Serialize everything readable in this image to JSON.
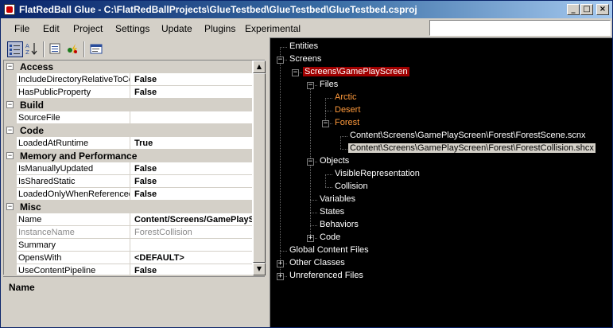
{
  "window": {
    "title": "FlatRedBall Glue - C:\\FlatRedBallProjects\\GlueTestbed\\GlueTestbed\\GlueTestbed.csproj",
    "buttons": {
      "minimize": "_",
      "maximize": "□",
      "close": "×"
    }
  },
  "menu": [
    "File",
    "Edit",
    "Project",
    "Settings",
    "Update",
    "Plugins",
    "Experimental"
  ],
  "search": {
    "value": ""
  },
  "toolbar": {
    "icons": [
      "categorized-icon",
      "alphabetical-icon",
      "property-pages-icon",
      "events-icon",
      "pages-icon"
    ]
  },
  "property_grid": {
    "rows": [
      {
        "type": "category",
        "name": "Access"
      },
      {
        "type": "property",
        "name": "IncludeDirectoryRelativeToContainer",
        "value": "False"
      },
      {
        "type": "property",
        "name": "HasPublicProperty",
        "value": "False"
      },
      {
        "type": "category",
        "name": "Build"
      },
      {
        "type": "property",
        "name": "SourceFile",
        "value": ""
      },
      {
        "type": "category",
        "name": "Code"
      },
      {
        "type": "property",
        "name": "LoadedAtRuntime",
        "value": "True"
      },
      {
        "type": "category",
        "name": "Memory and Performance"
      },
      {
        "type": "property",
        "name": "IsManuallyUpdated",
        "value": "False"
      },
      {
        "type": "property",
        "name": "IsSharedStatic",
        "value": "False"
      },
      {
        "type": "property",
        "name": "LoadedOnlyWhenReferenced",
        "value": "False"
      },
      {
        "type": "category",
        "name": "Misc"
      },
      {
        "type": "property",
        "name": "Name",
        "value": "Content/Screens/GamePlayScreen/Forest/ForestCollision.shcx"
      },
      {
        "type": "property",
        "name": "InstanceName",
        "value": "ForestCollision",
        "dim": true
      },
      {
        "type": "property",
        "name": "Summary",
        "value": ""
      },
      {
        "type": "property",
        "name": "OpensWith",
        "value": "<DEFAULT>"
      },
      {
        "type": "property",
        "name": "UseContentPipeline",
        "value": "False"
      }
    ],
    "description_title": "Name",
    "scroll": {
      "up": "▲",
      "down": "▼"
    }
  },
  "tree": {
    "nodes": [
      {
        "label": "Entities",
        "level": 0,
        "expander": null
      },
      {
        "label": "Screens",
        "level": 0,
        "expander": "−"
      },
      {
        "label": "Screens\\GamePlayScreen",
        "level": 1,
        "expander": "−",
        "style": "sel-red"
      },
      {
        "label": "Files",
        "level": 2,
        "expander": "−"
      },
      {
        "label": "Arctic",
        "level": 3,
        "expander": null,
        "style": "orange"
      },
      {
        "label": "Desert",
        "level": 3,
        "expander": null,
        "style": "orange"
      },
      {
        "label": "Forest",
        "level": 3,
        "expander": "−",
        "style": "orange"
      },
      {
        "label": "Content\\Screens\\GamePlayScreen\\Forest\\ForestScene.scnx",
        "level": 4,
        "expander": null
      },
      {
        "label": "Content\\Screens\\GamePlayScreen\\Forest\\ForestCollision.shcx",
        "level": 4,
        "expander": null,
        "style": "sel-gray"
      },
      {
        "label": "Objects",
        "level": 2,
        "expander": "−"
      },
      {
        "label": "VisibleRepresentation",
        "level": 3,
        "expander": null
      },
      {
        "label": "Collision",
        "level": 3,
        "expander": null
      },
      {
        "label": "Variables",
        "level": 2,
        "expander": null
      },
      {
        "label": "States",
        "level": 2,
        "expander": null
      },
      {
        "label": "Behaviors",
        "level": 2,
        "expander": null
      },
      {
        "label": "Code",
        "level": 2,
        "expander": "+"
      },
      {
        "label": "Global Content Files",
        "level": 0,
        "expander": null
      },
      {
        "label": "Other Classes",
        "level": 0,
        "expander": "+"
      },
      {
        "label": "Unreferenced Files",
        "level": 0,
        "expander": "+"
      }
    ]
  }
}
